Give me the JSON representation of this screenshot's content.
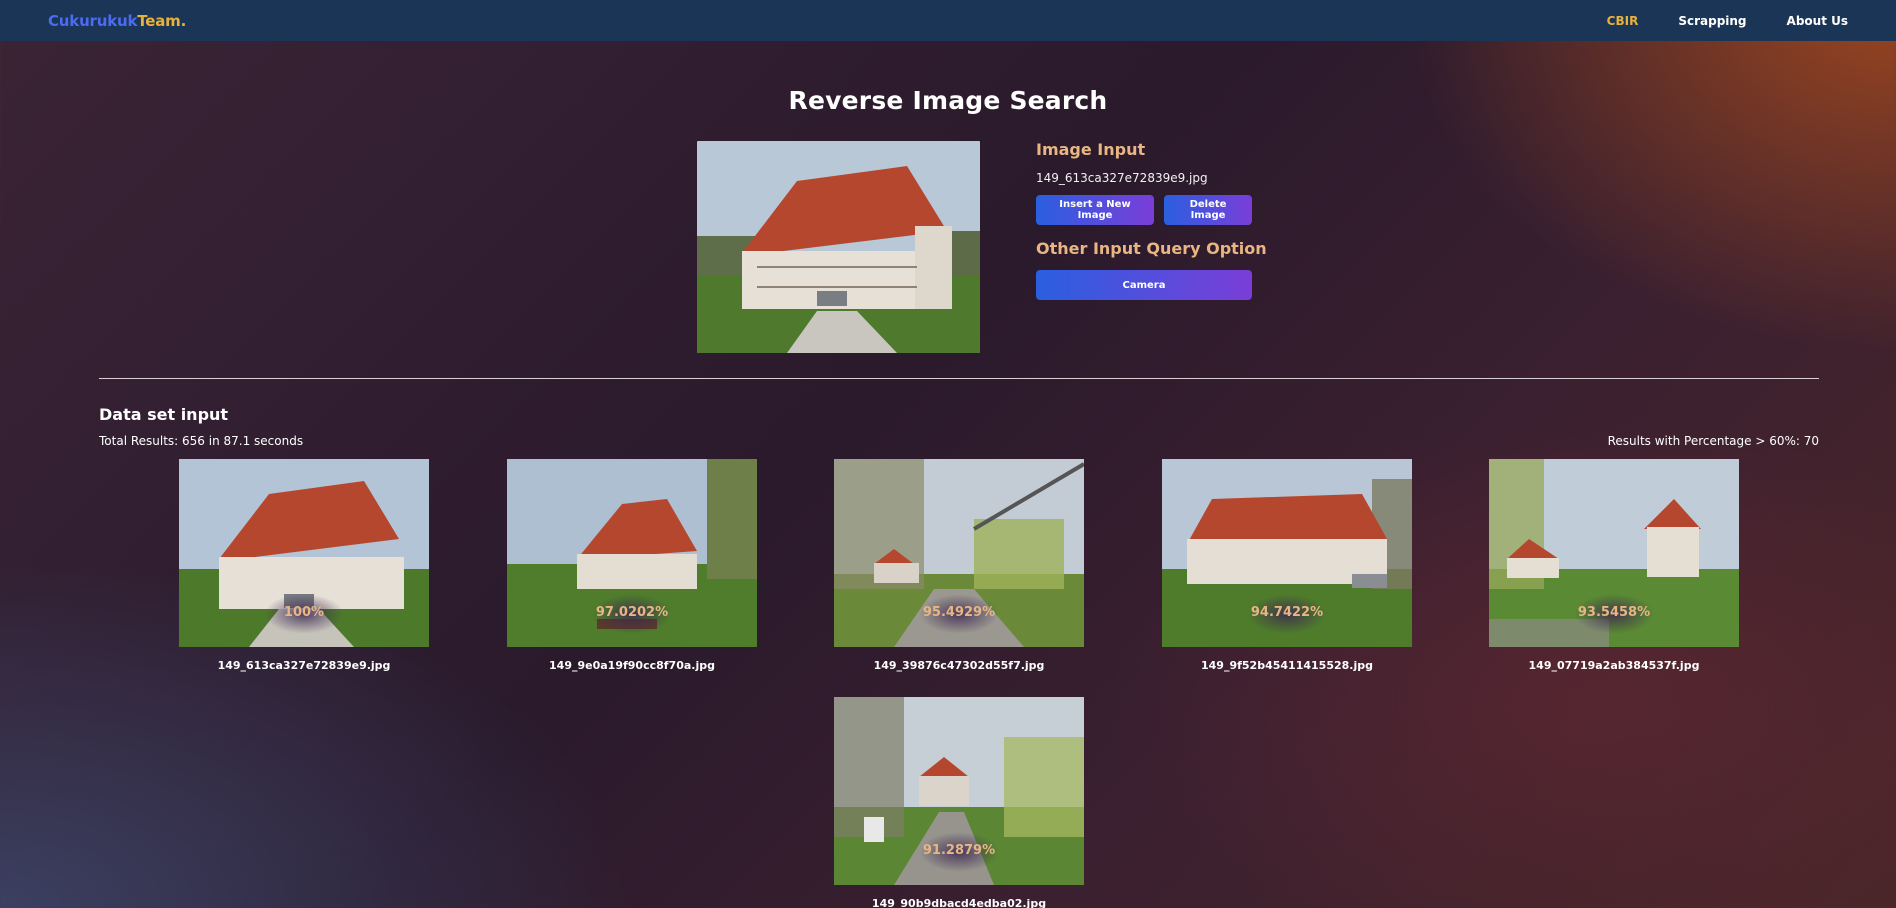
{
  "nav": {
    "brand_part1": "Cukurukuk",
    "brand_part2": "Team.",
    "links": [
      "CBIR",
      "Scrapping",
      "About Us"
    ],
    "active_link": "CBIR"
  },
  "page_title": "Reverse Image Search",
  "query": {
    "image_input_label": "Image Input",
    "filename": "149_613ca327e72839e9.jpg",
    "insert_button": "Insert a New Image",
    "delete_button": "Delete Image",
    "other_label": "Other Input Query Option",
    "camera_button": "Camera"
  },
  "dataset": {
    "title": "Data set input",
    "total_results": "Total Results: 656 in 87.1 seconds",
    "percentage_results": "Results with Percentage > 60%: 70",
    "results": [
      {
        "score": "100%",
        "filename": "149_613ca327e72839e9.jpg"
      },
      {
        "score": "97.0202%",
        "filename": "149_9e0a19f90cc8f70a.jpg"
      },
      {
        "score": "95.4929%",
        "filename": "149_39876c47302d55f7.jpg"
      },
      {
        "score": "94.7422%",
        "filename": "149_9f52b45411415528.jpg"
      },
      {
        "score": "93.5458%",
        "filename": "149_07719a2ab384537f.jpg"
      },
      {
        "score": "91.2879%",
        "filename": "149_90b9dbacd4edba02.jpg"
      }
    ]
  },
  "colors": {
    "navbar": "#1b3556",
    "accent_gold": "#e8b13a",
    "brand_blue": "#4b6cf0",
    "label_peach": "#e8b583",
    "button_gradient_start": "#2a5fe0",
    "button_gradient_end": "#7a3ed8"
  }
}
